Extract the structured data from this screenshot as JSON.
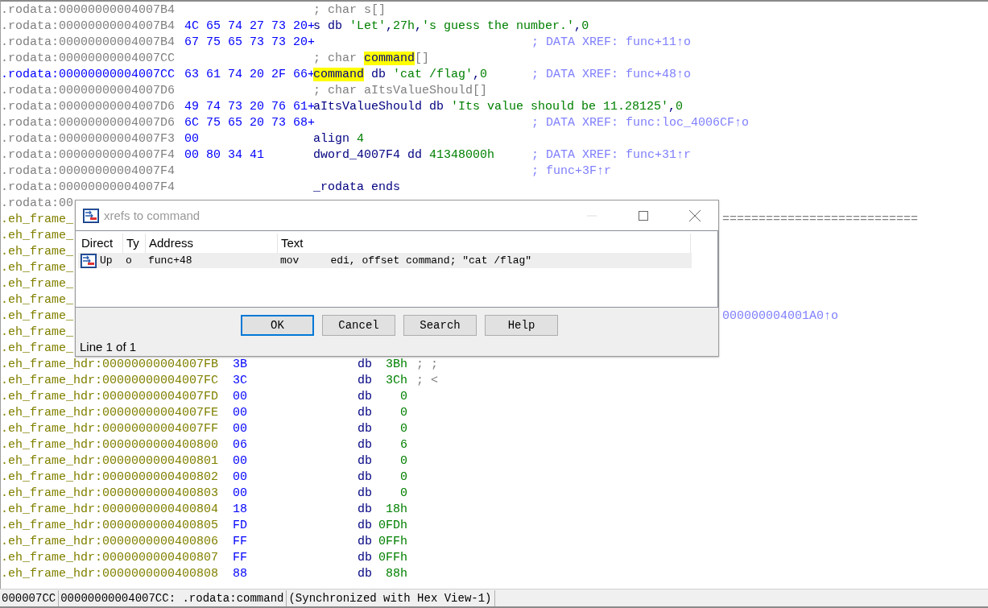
{
  "listing": {
    "rows": [
      {
        "kind": "rodata",
        "covered": false,
        "selected": false,
        "address": ".rodata:00000000004007B4",
        "code": [
          {
            "text": "; char s[]",
            "kind": "comment"
          }
        ]
      },
      {
        "kind": "rodata",
        "covered": false,
        "selected": false,
        "address": ".rodata:00000000004007B4",
        "bytes": "4C 65 74 27 73 20+",
        "code": [
          {
            "text": "s db ",
            "kind": "label"
          },
          {
            "text": "'Let'",
            "kind": "string"
          },
          {
            "text": ",",
            "kind": "punct"
          },
          {
            "text": "27h",
            "kind": "number"
          },
          {
            "text": ",",
            "kind": "punct"
          },
          {
            "text": "'s guess the number.'",
            "kind": "string"
          },
          {
            "text": ",",
            "kind": "punct"
          },
          {
            "text": "0",
            "kind": "number"
          }
        ]
      },
      {
        "kind": "rodata",
        "covered": false,
        "selected": false,
        "address": ".rodata:00000000004007B4",
        "bytes": "67 75 65 73 73 20+",
        "comment": [
          {
            "text": "; DATA XREF: func+11↑o",
            "kind": "xref"
          }
        ]
      },
      {
        "kind": "rodata",
        "covered": false,
        "selected": false,
        "address": ".rodata:00000000004007CC",
        "code": [
          {
            "text": "; char ",
            "kind": "comment"
          },
          {
            "text": "command",
            "kind": "highlight"
          },
          {
            "text": "[]",
            "kind": "comment"
          }
        ]
      },
      {
        "kind": "rodata",
        "covered": false,
        "selected": true,
        "address": ".rodata:00000000004007CC",
        "bytes": "63 61 74 20 2F 66+",
        "code": [
          {
            "text": "command",
            "kind": "highlight"
          },
          {
            "text": " db ",
            "kind": "label"
          },
          {
            "text": "'cat /flag'",
            "kind": "string"
          },
          {
            "text": ",",
            "kind": "punct"
          },
          {
            "text": "0",
            "kind": "number"
          }
        ],
        "comment": [
          {
            "text": "; DATA XREF: func+48↑o",
            "kind": "xref"
          }
        ]
      },
      {
        "kind": "rodata",
        "covered": false,
        "selected": false,
        "address": ".rodata:00000000004007D6",
        "code": [
          {
            "text": "; char aItsValueShould[]",
            "kind": "comment"
          }
        ]
      },
      {
        "kind": "rodata",
        "covered": false,
        "selected": false,
        "address": ".rodata:00000000004007D6",
        "bytes": "49 74 73 20 76 61+",
        "code": [
          {
            "text": "aItsValueShould db ",
            "kind": "label"
          },
          {
            "text": "'Its value should be 11.28125'",
            "kind": "string"
          },
          {
            "text": ",",
            "kind": "punct"
          },
          {
            "text": "0",
            "kind": "number"
          }
        ]
      },
      {
        "kind": "rodata",
        "covered": false,
        "selected": false,
        "address": ".rodata:00000000004007D6",
        "bytes": "6C 75 65 20 73 68+",
        "comment": [
          {
            "text": "; DATA XREF: func:loc_4006CF↑o",
            "kind": "xref"
          }
        ]
      },
      {
        "kind": "rodata",
        "covered": false,
        "selected": false,
        "address": ".rodata:00000000004007F3",
        "bytes": "00",
        "code": [
          {
            "text": "align ",
            "kind": "label"
          },
          {
            "text": "4",
            "kind": "number"
          }
        ]
      },
      {
        "kind": "rodata",
        "covered": false,
        "selected": false,
        "address": ".rodata:00000000004007F4",
        "bytes": "00 80 34 41",
        "code": [
          {
            "text": "dword_4007F4 dd ",
            "kind": "label"
          },
          {
            "text": "41348000h",
            "kind": "number"
          }
        ],
        "comment": [
          {
            "text": "; DATA XREF: func+31↑r",
            "kind": "xref"
          }
        ]
      },
      {
        "kind": "rodata",
        "covered": false,
        "selected": false,
        "address": ".rodata:00000000004007F4",
        "comment": [
          {
            "text": "; func+3F↑r",
            "kind": "xref"
          }
        ]
      },
      {
        "kind": "rodata",
        "covered": false,
        "selected": false,
        "address": ".rodata:00000000004007F4",
        "code": [
          {
            "text": "_rodata ends",
            "kind": "label"
          }
        ]
      },
      {
        "kind": "rodata",
        "covered": true,
        "selected": false,
        "address": ".rodata:00"
      },
      {
        "kind": "eh_frame",
        "covered": true,
        "selected": false,
        "address": ".eh_frame_",
        "right": [
          {
            "text": "===========================",
            "kind": "comment"
          }
        ]
      },
      {
        "kind": "eh_frame",
        "covered": true,
        "selected": false,
        "address": ".eh_frame_"
      },
      {
        "kind": "eh_frame",
        "covered": true,
        "selected": false,
        "address": ".eh_frame_"
      },
      {
        "kind": "eh_frame",
        "covered": true,
        "selected": false,
        "address": ".eh_frame_"
      },
      {
        "kind": "eh_frame",
        "covered": true,
        "selected": false,
        "address": ".eh_frame_"
      },
      {
        "kind": "eh_frame",
        "covered": true,
        "selected": false,
        "address": ".eh_frame_"
      },
      {
        "kind": "eh_frame",
        "covered": true,
        "selected": false,
        "address": ".eh_frame_",
        "right": [
          {
            "text": "000000004001A0↑o",
            "kind": "xref"
          }
        ]
      },
      {
        "kind": "eh_frame",
        "covered": true,
        "selected": false,
        "address": ".eh_frame_"
      },
      {
        "kind": "eh_frame",
        "covered": true,
        "selected": false,
        "address": ".eh_frame_"
      },
      {
        "kind": "eh_frame",
        "covered": false,
        "selected": false,
        "address": ".eh_frame_hdr:00000000004007FB",
        "bytes": "3B",
        "mnemonic": "db",
        "operand": "3Bh",
        "note": "; ;"
      },
      {
        "kind": "eh_frame",
        "covered": false,
        "selected": false,
        "address": ".eh_frame_hdr:00000000004007FC",
        "bytes": "3C",
        "mnemonic": "db",
        "operand": "3Ch",
        "note": "; <"
      },
      {
        "kind": "eh_frame",
        "covered": false,
        "selected": false,
        "address": ".eh_frame_hdr:00000000004007FD",
        "bytes": "00",
        "mnemonic": "db",
        "operand": "0"
      },
      {
        "kind": "eh_frame",
        "covered": false,
        "selected": false,
        "address": ".eh_frame_hdr:00000000004007FE",
        "bytes": "00",
        "mnemonic": "db",
        "operand": "0"
      },
      {
        "kind": "eh_frame",
        "covered": false,
        "selected": false,
        "address": ".eh_frame_hdr:00000000004007FF",
        "bytes": "00",
        "mnemonic": "db",
        "operand": "0"
      },
      {
        "kind": "eh_frame",
        "covered": false,
        "selected": false,
        "address": ".eh_frame_hdr:0000000000400800",
        "bytes": "06",
        "mnemonic": "db",
        "operand": "6"
      },
      {
        "kind": "eh_frame",
        "covered": false,
        "selected": false,
        "address": ".eh_frame_hdr:0000000000400801",
        "bytes": "00",
        "mnemonic": "db",
        "operand": "0"
      },
      {
        "kind": "eh_frame",
        "covered": false,
        "selected": false,
        "address": ".eh_frame_hdr:0000000000400802",
        "bytes": "00",
        "mnemonic": "db",
        "operand": "0"
      },
      {
        "kind": "eh_frame",
        "covered": false,
        "selected": false,
        "address": ".eh_frame_hdr:0000000000400803",
        "bytes": "00",
        "mnemonic": "db",
        "operand": "0"
      },
      {
        "kind": "eh_frame",
        "covered": false,
        "selected": false,
        "address": ".eh_frame_hdr:0000000000400804",
        "bytes": "18",
        "mnemonic": "db",
        "operand": "18h"
      },
      {
        "kind": "eh_frame",
        "covered": false,
        "selected": false,
        "address": ".eh_frame_hdr:0000000000400805",
        "bytes": "FD",
        "mnemonic": "db",
        "operand": "0FDh"
      },
      {
        "kind": "eh_frame",
        "covered": false,
        "selected": false,
        "address": ".eh_frame_hdr:0000000000400806",
        "bytes": "FF",
        "mnemonic": "db",
        "operand": "0FFh"
      },
      {
        "kind": "eh_frame",
        "covered": false,
        "selected": false,
        "address": ".eh_frame_hdr:0000000000400807",
        "bytes": "FF",
        "mnemonic": "db",
        "operand": "0FFh"
      },
      {
        "kind": "eh_frame",
        "covered": false,
        "selected": false,
        "address": ".eh_frame_hdr:0000000000400808",
        "bytes": "88",
        "mnemonic": "db",
        "operand": "88h"
      }
    ]
  },
  "dialog": {
    "title": "xrefs to command",
    "columns": [
      "Direct",
      "Ty",
      "Address",
      "Text"
    ],
    "rows": [
      {
        "selected": true,
        "direction": "Up",
        "type": "o",
        "address": "func+48",
        "text": "mov     edi, offset command; \"cat /flag\""
      }
    ],
    "buttons": [
      {
        "label": "OK",
        "focused": true
      },
      {
        "label": "Cancel",
        "focused": false
      },
      {
        "label": "Search",
        "focused": false
      },
      {
        "label": "Help",
        "focused": false
      }
    ],
    "status": "Line 1 of 1"
  },
  "status_bar": [
    "000007CC",
    "00000000004007CC: .rodata:command",
    "(Synchronized with Hex View-1)"
  ]
}
